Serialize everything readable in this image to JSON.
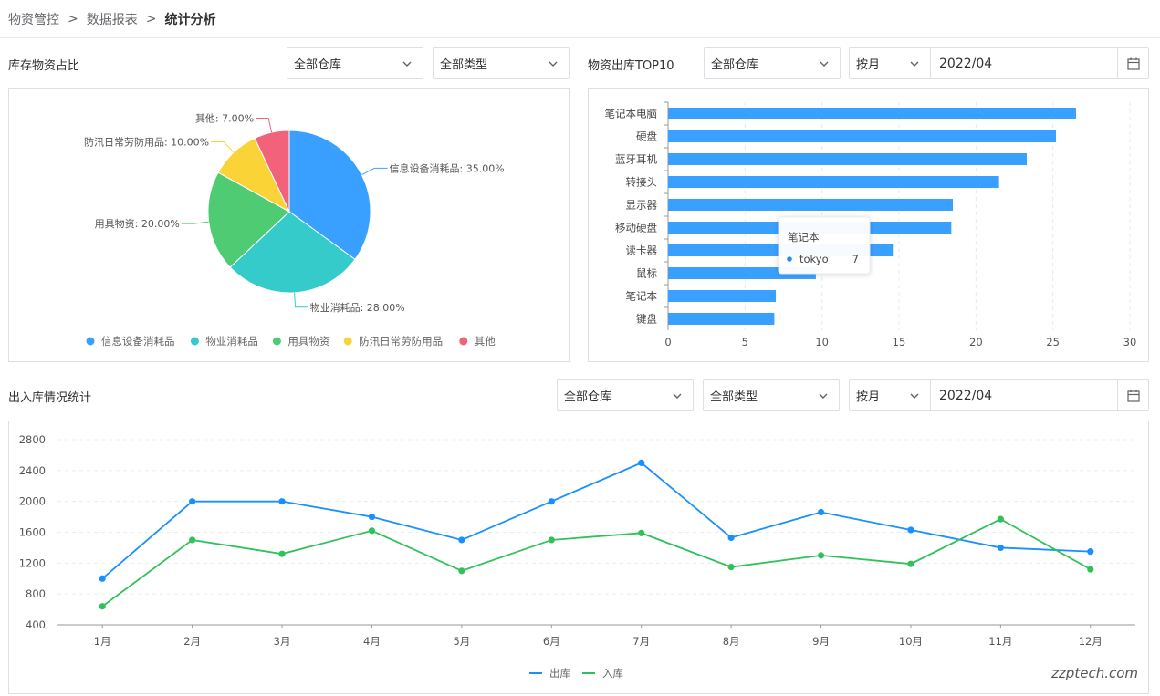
{
  "breadcrumb": {
    "item1": "物资管控",
    "sep": ">",
    "item2": "数据报表",
    "current": "统计分析"
  },
  "inventory_ratio": {
    "title": "库存物资占比",
    "filter_warehouse": "全部仓库",
    "filter_type": "全部类型"
  },
  "outbound_top10": {
    "title": "物资出库TOP10",
    "filter_warehouse": "全部仓库",
    "period": "按月",
    "date": "2022/04",
    "tooltip": {
      "title": "笔记本",
      "series": "tokyo",
      "value": "7"
    }
  },
  "inout_stats": {
    "title": "出入库情况统计",
    "filter_warehouse": "全部仓库",
    "filter_type": "全部类型",
    "period": "按月",
    "date": "2022/04"
  },
  "watermark": "zzptech.com",
  "colors": {
    "blue": "#3aa0ff",
    "cyan": "#36cbcb",
    "green": "#4ecb73",
    "yellow": "#fad337",
    "red": "#f2637b",
    "line_blue": "#1890ff",
    "line_green": "#2fc25b"
  },
  "chart_data": [
    {
      "type": "pie",
      "categories": [
        "信息设备消耗品",
        "物业消耗品",
        "用具物资",
        "防汛日常劳防用品",
        "其他"
      ],
      "values": [
        35.0,
        28.0,
        20.0,
        10.0,
        7.0
      ],
      "slice_labels": [
        "信息设备消耗品: 35.00%",
        "物业消耗品: 28.00%",
        "用具物资: 20.00%",
        "防汛日常劳防用品: 10.00%",
        "其他: 7.00%"
      ],
      "legend": "bottom"
    },
    {
      "type": "bar",
      "orientation": "horizontal",
      "categories": [
        "笔记本电脑",
        "硬盘",
        "蓝牙耳机",
        "转接头",
        "显示器",
        "移动硬盘",
        "读卡器",
        "鼠标",
        "笔记本",
        "键盘"
      ],
      "values": [
        26.5,
        25.2,
        23.3,
        21.5,
        18.5,
        18.4,
        14.6,
        9.6,
        7.0,
        6.9
      ],
      "xlim": [
        0,
        30
      ],
      "xticks": [
        "0",
        "5",
        "10",
        "15",
        "20",
        "25",
        "30"
      ],
      "grid": true
    },
    {
      "type": "line",
      "categories": [
        "1月",
        "2月",
        "3月",
        "4月",
        "5月",
        "6月",
        "7月",
        "8月",
        "9月",
        "10月",
        "11月",
        "12月"
      ],
      "series": [
        {
          "name": "出库",
          "values": [
            1000,
            2000,
            2000,
            1800,
            1500,
            2000,
            2500,
            1530,
            1860,
            1630,
            1400,
            1350
          ]
        },
        {
          "name": "入库",
          "values": [
            640,
            1500,
            1320,
            1620,
            1100,
            1500,
            1590,
            1150,
            1300,
            1190,
            1770,
            1120
          ]
        }
      ],
      "ylim": [
        400,
        2800
      ],
      "yticks": [
        "2800",
        "2400",
        "2000",
        "1600",
        "1200",
        "800",
        "400"
      ],
      "legend": "bottom"
    }
  ]
}
